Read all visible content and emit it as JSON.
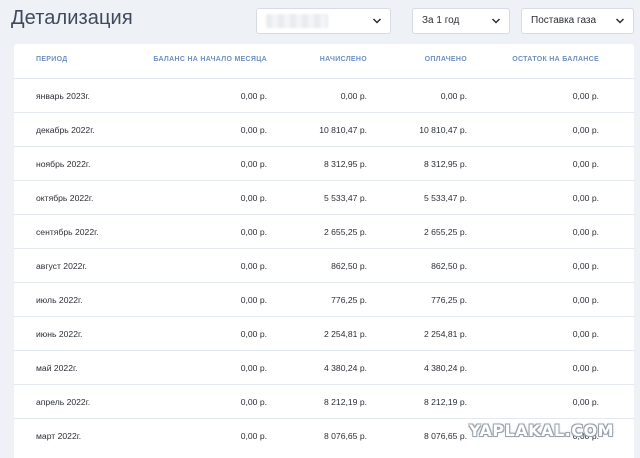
{
  "header": {
    "title": "Детализация",
    "account_select": {
      "value": ""
    },
    "period_select": {
      "value": "За 1 год"
    },
    "service_select": {
      "value": "Поставка газа"
    }
  },
  "table": {
    "columns": [
      "Период",
      "Баланс на начало месяца",
      "Начислено",
      "Оплачено",
      "Остаток на балансе"
    ],
    "rows": [
      [
        "январь 2023г.",
        "0,00 р.",
        "0,00 р.",
        "0,00 р.",
        "0,00 р."
      ],
      [
        "декабрь 2022г.",
        "0,00 р.",
        "10 810,47 р.",
        "10 810,47 р.",
        "0,00 р."
      ],
      [
        "ноябрь 2022г.",
        "0,00 р.",
        "8 312,95 р.",
        "8 312,95 р.",
        "0,00 р."
      ],
      [
        "октябрь 2022г.",
        "0,00 р.",
        "5 533,47 р.",
        "5 533,47 р.",
        "0,00 р."
      ],
      [
        "сентябрь 2022г.",
        "0,00 р.",
        "2 655,25 р.",
        "2 655,25 р.",
        "0,00 р."
      ],
      [
        "август 2022г.",
        "0,00 р.",
        "862,50 р.",
        "862,50 р.",
        "0,00 р."
      ],
      [
        "июль 2022г.",
        "0,00 р.",
        "776,25 р.",
        "776,25 р.",
        "0,00 р."
      ],
      [
        "июнь 2022г.",
        "0,00 р.",
        "2 254,81 р.",
        "2 254,81 р.",
        "0,00 р."
      ],
      [
        "май 2022г.",
        "0,00 р.",
        "4 380,24 р.",
        "4 380,24 р.",
        "0,00 р."
      ],
      [
        "апрель 2022г.",
        "0,00 р.",
        "8 212,19 р.",
        "8 212,19 р.",
        "0,00 р."
      ],
      [
        "март 2022г.",
        "0,00 р.",
        "8 076,65 р.",
        "8 076,65 р.",
        "0,00 р."
      ]
    ]
  },
  "watermark": "YAPLAKAL.COM"
}
